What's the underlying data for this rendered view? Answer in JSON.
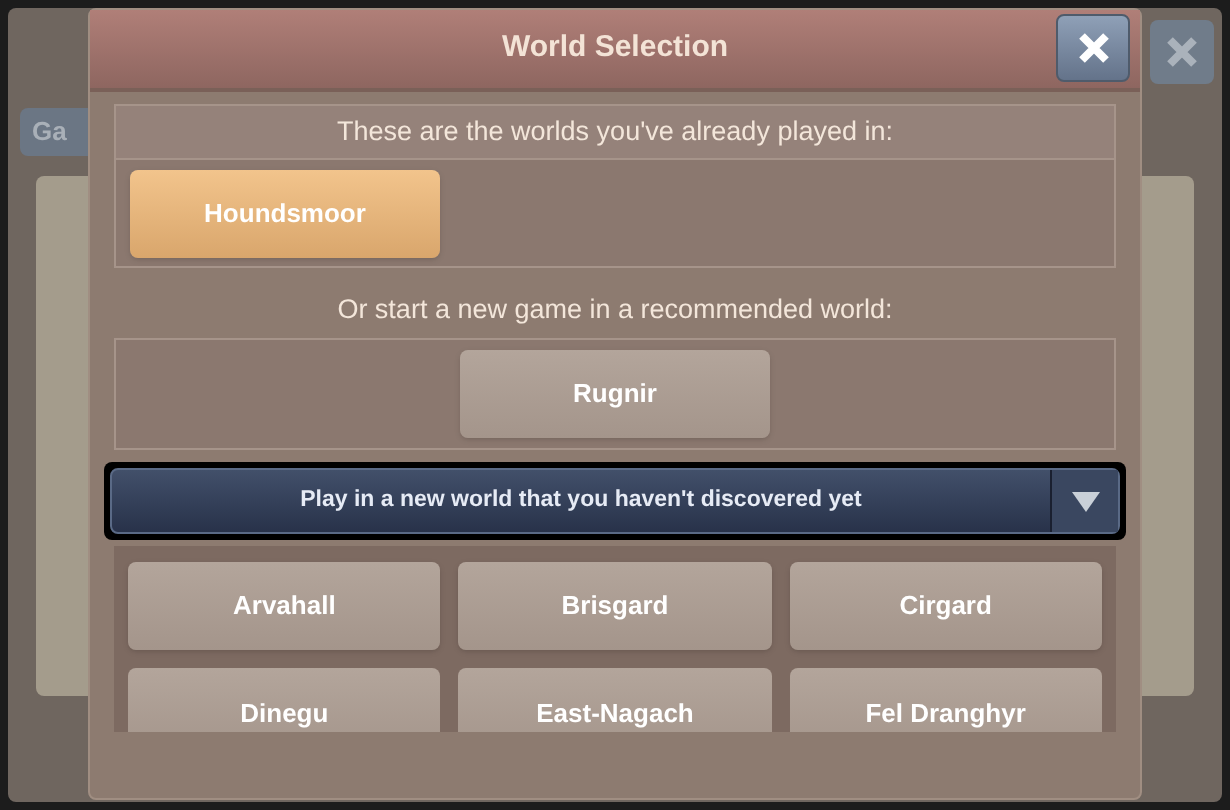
{
  "background": {
    "tab_label": "Ga"
  },
  "window": {
    "title": "World Selection"
  },
  "played": {
    "heading": "These are the worlds you've already played in:",
    "worlds": [
      "Houndsmoor"
    ]
  },
  "recommended": {
    "heading": "Or start a new game in a recommended world:",
    "worlds": [
      "Rugnir"
    ]
  },
  "dropdown": {
    "value": "Play in a new world that you haven't discovered yet",
    "expanded": false
  },
  "worlds": [
    "Arvahall",
    "Brisgard",
    "Cirgard",
    "Dinegu",
    "East-Nagach",
    "Fel Dranghyr"
  ]
}
